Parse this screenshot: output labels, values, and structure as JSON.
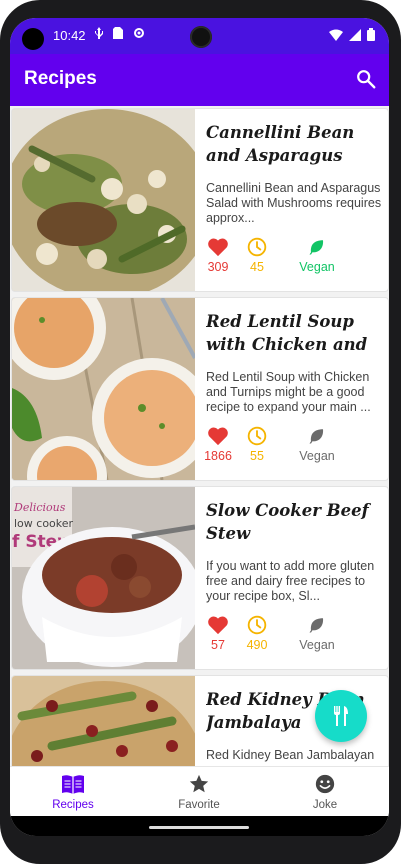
{
  "status": {
    "time": "10:42"
  },
  "appbar": {
    "title": "Recipes"
  },
  "recipes": [
    {
      "title": "Cannellini Bean and Asparagus Salad w...",
      "description": "Cannellini Bean and Asparagus Salad with Mushrooms requires approx...",
      "likes": "309",
      "minutes": "45",
      "vegan_label": "Vegan",
      "vegan": true
    },
    {
      "title": "Red Lentil Soup with Chicken and Turnips",
      "description": "Red Lentil Soup with Chicken and Turnips might be a good recipe to expand your main ...",
      "likes": "1866",
      "minutes": "55",
      "vegan_label": "Vegan",
      "vegan": false
    },
    {
      "title": "Slow Cooker Beef Stew",
      "description": "If you want to add more gluten free and dairy free recipes to your recipe box, Sl...",
      "likes": "57",
      "minutes": "490",
      "vegan_label": "Vegan",
      "vegan": false
    },
    {
      "title": "Red Kidney Bean Jambalaya",
      "description": "Red Kidney Bean Jambalayan",
      "image_text": ""
    }
  ],
  "image2_overlay": {
    "line1": "Delicious",
    "line2": "low cooker",
    "line3": "f Stew"
  },
  "bottom_nav": {
    "items": [
      {
        "label": "Recipes",
        "icon": "book-icon",
        "active": true
      },
      {
        "label": "Favorite",
        "icon": "star-icon",
        "active": false
      },
      {
        "label": "Joke",
        "icon": "smiley-icon",
        "active": false
      }
    ]
  },
  "colors": {
    "primary": "#6200ee",
    "status_bar": "#4a12e0",
    "fab": "#16dcc9",
    "favorite": "#e53935",
    "time": "#f5b400",
    "vegan_on": "#12c465",
    "vegan_off": "#6b6b6b"
  }
}
